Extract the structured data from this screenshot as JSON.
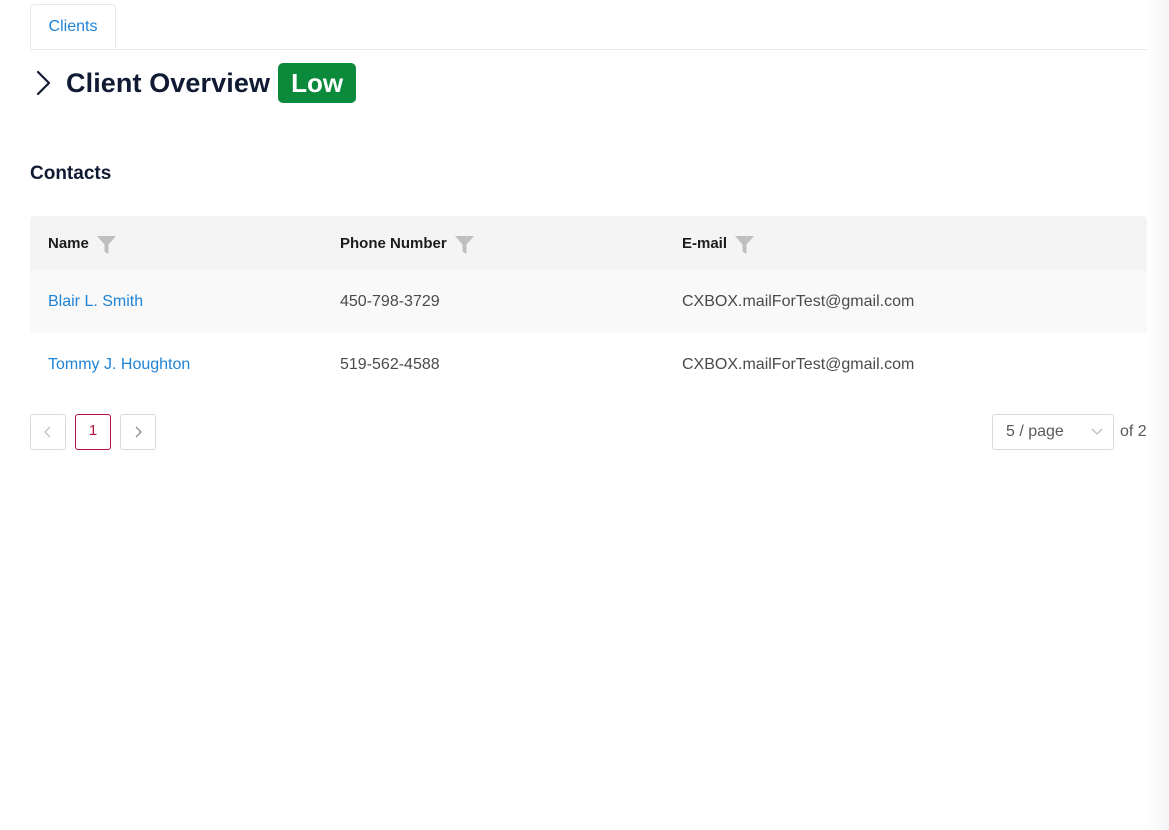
{
  "tabs": [
    {
      "label": "Clients"
    }
  ],
  "header": {
    "title": "Client Overview",
    "badge": {
      "label": "Low",
      "color": "#0b8a3c"
    },
    "expand_icon": "chevron-right-icon"
  },
  "contacts": {
    "title": "Contacts",
    "columns": [
      {
        "label": "Name",
        "filter_icon": "filter-icon"
      },
      {
        "label": "Phone Number",
        "filter_icon": "filter-icon"
      },
      {
        "label": "E-mail",
        "filter_icon": "filter-icon"
      }
    ],
    "rows": [
      {
        "name": "Blair L. Smith",
        "phone": "450-798-3729",
        "email": "CXBOX.mailForTest@gmail.com"
      },
      {
        "name": "Tommy J. Houghton",
        "phone": "519-562-4588",
        "email": "CXBOX.mailForTest@gmail.com"
      }
    ]
  },
  "pagination": {
    "current_page": "1",
    "page_size": "5 / page",
    "total_label": "of 2",
    "prev_icon": "chevron-left-icon",
    "next_icon": "chevron-right-icon",
    "active_color": "#b0123c"
  },
  "colors": {
    "link": "#1f83d6",
    "heading": "#111a33"
  }
}
